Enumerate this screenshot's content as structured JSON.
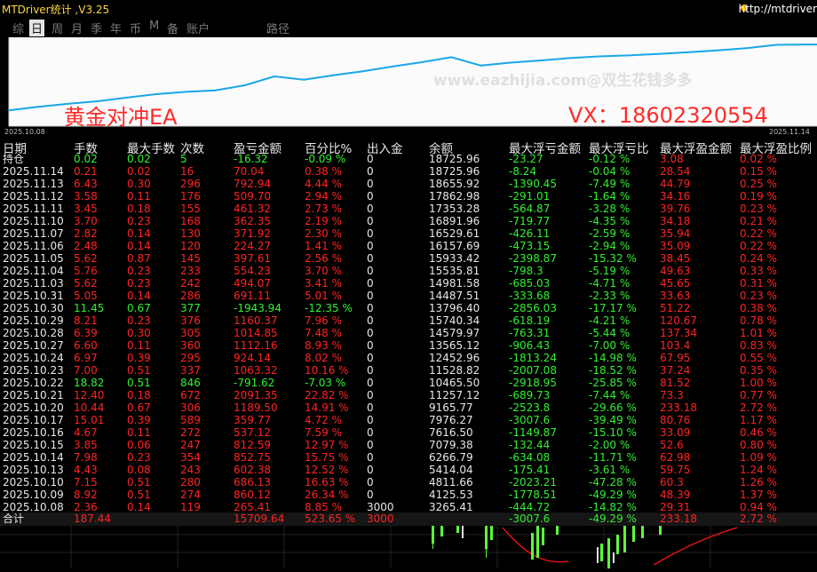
{
  "app": {
    "title": "MTDriver统计 ,V3.25",
    "url": "http://mtdriver"
  },
  "tabs": [
    "综",
    "日",
    "周",
    "月",
    "季",
    "年",
    "币",
    "M",
    "备",
    "账户",
    "路径"
  ],
  "active_tab": "日",
  "chart": {
    "watermark": "www.eazhijia.com@双生花钱多多",
    "label": "黄金对冲EA",
    "contact": "VX：18602320554",
    "start_date": "2025.10.08",
    "end_date": "2025.11.14",
    "line_color": "#1aa7e6",
    "chart_data": {
      "type": "line",
      "title": "",
      "xlabel": "",
      "ylabel": "",
      "x": [
        "2025.10.08",
        "2025.10.09",
        "2025.10.10",
        "2025.10.13",
        "2025.10.14",
        "2025.10.15",
        "2025.10.16",
        "2025.10.17",
        "2025.10.20",
        "2025.10.21",
        "2025.10.22",
        "2025.10.23",
        "2025.10.24",
        "2025.10.27",
        "2025.10.28",
        "2025.10.29",
        "2025.10.30",
        "2025.10.31",
        "2025.11.03",
        "2025.11.04",
        "2025.11.05",
        "2025.11.06",
        "2025.11.07",
        "2025.11.10",
        "2025.11.11",
        "2025.11.12",
        "2025.11.13",
        "2025.11.14"
      ],
      "values": [
        3265.41,
        4125.53,
        4811.66,
        5414.04,
        6266.79,
        7079.38,
        7616.5,
        7976.27,
        9165.77,
        11257.12,
        10465.5,
        11528.82,
        12452.96,
        13565.12,
        14579.97,
        15740.34,
        13796.4,
        14487.51,
        14981.58,
        15535.81,
        15933.42,
        16157.69,
        16529.61,
        16891.96,
        17353.28,
        17862.98,
        18655.92,
        18725.96
      ]
    }
  },
  "table": {
    "headers": [
      "日期",
      "手数",
      "最大手数",
      "次数",
      "盈亏金额",
      "百分比%",
      "出入金",
      "余额",
      "最大浮亏金额",
      "最大浮亏比",
      "最大浮盈金额",
      "最大浮盈比例"
    ],
    "rows": [
      {
        "date": "持仓",
        "lots": "0.02",
        "max_lots": "0.02",
        "count": "5",
        "pnl": "-16.32",
        "pct": "-0.09 %",
        "io": "0",
        "bal": "18725.96",
        "fl": "-23.27",
        "flp": "-0.12 %",
        "fp": "3.08",
        "fpp": "0.02 %",
        "color": "green"
      },
      {
        "date": "2025.11.14",
        "lots": "0.21",
        "max_lots": "0.02",
        "count": "16",
        "pnl": "70.04",
        "pct": "0.38 %",
        "io": "0",
        "bal": "18725.96",
        "fl": "-8.24",
        "flp": "-0.04 %",
        "fp": "28.54",
        "fpp": "0.15 %",
        "color": "red"
      },
      {
        "date": "2025.11.13",
        "lots": "6.43",
        "max_lots": "0.30",
        "count": "296",
        "pnl": "792.94",
        "pct": "4.44 %",
        "io": "0",
        "bal": "18655.92",
        "fl": "-1390.45",
        "flp": "-7.49 %",
        "fp": "44.79",
        "fpp": "0.25 %",
        "color": "red"
      },
      {
        "date": "2025.11.12",
        "lots": "3.58",
        "max_lots": "0.11",
        "count": "176",
        "pnl": "509.70",
        "pct": "2.94 %",
        "io": "0",
        "bal": "17862.98",
        "fl": "-291.01",
        "flp": "-1.64 %",
        "fp": "34.16",
        "fpp": "0.19 %",
        "color": "red"
      },
      {
        "date": "2025.11.11",
        "lots": "3.45",
        "max_lots": "0.18",
        "count": "155",
        "pnl": "461.32",
        "pct": "2.73 %",
        "io": "0",
        "bal": "17353.28",
        "fl": "-564.87",
        "flp": "-3.28 %",
        "fp": "39.76",
        "fpp": "0.23 %",
        "color": "red"
      },
      {
        "date": "2025.11.10",
        "lots": "3.70",
        "max_lots": "0.23",
        "count": "168",
        "pnl": "362.35",
        "pct": "2.19 %",
        "io": "0",
        "bal": "16891.96",
        "fl": "-719.77",
        "flp": "-4.35 %",
        "fp": "34.18",
        "fpp": "0.21 %",
        "color": "red"
      },
      {
        "date": "2025.11.07",
        "lots": "2.82",
        "max_lots": "0.14",
        "count": "130",
        "pnl": "371.92",
        "pct": "2.30 %",
        "io": "0",
        "bal": "16529.61",
        "fl": "-426.11",
        "flp": "-2.59 %",
        "fp": "35.94",
        "fpp": "0.22 %",
        "color": "red"
      },
      {
        "date": "2025.11.06",
        "lots": "2.48",
        "max_lots": "0.14",
        "count": "120",
        "pnl": "224.27",
        "pct": "1.41 %",
        "io": "0",
        "bal": "16157.69",
        "fl": "-473.15",
        "flp": "-2.94 %",
        "fp": "35.09",
        "fpp": "0.22 %",
        "color": "red"
      },
      {
        "date": "2025.11.05",
        "lots": "5.62",
        "max_lots": "0.87",
        "count": "145",
        "pnl": "397.61",
        "pct": "2.56 %",
        "io": "0",
        "bal": "15933.42",
        "fl": "-2398.87",
        "flp": "-15.32 %",
        "fp": "38.45",
        "fpp": "0.24 %",
        "color": "red"
      },
      {
        "date": "2025.11.04",
        "lots": "5.76",
        "max_lots": "0.23",
        "count": "233",
        "pnl": "554.23",
        "pct": "3.70 %",
        "io": "0",
        "bal": "15535.81",
        "fl": "-798.3",
        "flp": "-5.19 %",
        "fp": "49.63",
        "fpp": "0.33 %",
        "color": "red"
      },
      {
        "date": "2025.11.03",
        "lots": "5.62",
        "max_lots": "0.23",
        "count": "242",
        "pnl": "494.07",
        "pct": "3.41 %",
        "io": "0",
        "bal": "14981.58",
        "fl": "-685.03",
        "flp": "-4.71 %",
        "fp": "45.65",
        "fpp": "0.31 %",
        "color": "red"
      },
      {
        "date": "2025.10.31",
        "lots": "5.05",
        "max_lots": "0.14",
        "count": "286",
        "pnl": "691.11",
        "pct": "5.01 %",
        "io": "0",
        "bal": "14487.51",
        "fl": "-333.68",
        "flp": "-2.33 %",
        "fp": "33.63",
        "fpp": "0.23 %",
        "color": "red"
      },
      {
        "date": "2025.10.30",
        "lots": "11.45",
        "max_lots": "0.67",
        "count": "377",
        "pnl": "-1943.94",
        "pct": "-12.35 %",
        "io": "0",
        "bal": "13796.40",
        "fl": "-2856.03",
        "flp": "-17.17 %",
        "fp": "51.22",
        "fpp": "0.38 %",
        "color": "green"
      },
      {
        "date": "2025.10.29",
        "lots": "8.21",
        "max_lots": "0.23",
        "count": "376",
        "pnl": "1160.37",
        "pct": "7.96 %",
        "io": "0",
        "bal": "15740.34",
        "fl": "-618.19",
        "flp": "-4.21 %",
        "fp": "120.67",
        "fpp": "0.78 %",
        "color": "red"
      },
      {
        "date": "2025.10.28",
        "lots": "6.39",
        "max_lots": "0.30",
        "count": "305",
        "pnl": "1014.85",
        "pct": "7.48 %",
        "io": "0",
        "bal": "14579.97",
        "fl": "-763.31",
        "flp": "-5.44 %",
        "fp": "137.34",
        "fpp": "1.01 %",
        "color": "red"
      },
      {
        "date": "2025.10.27",
        "lots": "6.60",
        "max_lots": "0.11",
        "count": "360",
        "pnl": "1112.16",
        "pct": "8.93 %",
        "io": "0",
        "bal": "13565.12",
        "fl": "-906.43",
        "flp": "-7.00 %",
        "fp": "103.4",
        "fpp": "0.83 %",
        "color": "red"
      },
      {
        "date": "2025.10.24",
        "lots": "6.97",
        "max_lots": "0.39",
        "count": "295",
        "pnl": "924.14",
        "pct": "8.02 %",
        "io": "0",
        "bal": "12452.96",
        "fl": "-1813.24",
        "flp": "-14.98 %",
        "fp": "67.95",
        "fpp": "0.55 %",
        "color": "red"
      },
      {
        "date": "2025.10.23",
        "lots": "7.00",
        "max_lots": "0.51",
        "count": "337",
        "pnl": "1063.32",
        "pct": "10.16 %",
        "io": "0",
        "bal": "11528.82",
        "fl": "-2007.08",
        "flp": "-18.52 %",
        "fp": "37.24",
        "fpp": "0.35 %",
        "color": "red"
      },
      {
        "date": "2025.10.22",
        "lots": "18.82",
        "max_lots": "0.51",
        "count": "846",
        "pnl": "-791.62",
        "pct": "-7.03 %",
        "io": "0",
        "bal": "10465.50",
        "fl": "-2918.95",
        "flp": "-25.85 %",
        "fp": "81.52",
        "fpp": "1.00 %",
        "color": "green"
      },
      {
        "date": "2025.10.21",
        "lots": "12.40",
        "max_lots": "0.18",
        "count": "672",
        "pnl": "2091.35",
        "pct": "22.82 %",
        "io": "0",
        "bal": "11257.12",
        "fl": "-689.73",
        "flp": "-7.44 %",
        "fp": "73.3",
        "fpp": "0.77 %",
        "color": "red"
      },
      {
        "date": "2025.10.20",
        "lots": "10.44",
        "max_lots": "0.67",
        "count": "306",
        "pnl": "1189.50",
        "pct": "14.91 %",
        "io": "0",
        "bal": "9165.77",
        "fl": "-2523.8",
        "flp": "-29.66 %",
        "fp": "233.18",
        "fpp": "2.72 %",
        "color": "red"
      },
      {
        "date": "2025.10.17",
        "lots": "15.01",
        "max_lots": "0.39",
        "count": "589",
        "pnl": "359.77",
        "pct": "4.72 %",
        "io": "0",
        "bal": "7976.27",
        "fl": "-3007.6",
        "flp": "-39.49 %",
        "fp": "80.76",
        "fpp": "1.17 %",
        "color": "red"
      },
      {
        "date": "2025.10.16",
        "lots": "4.67",
        "max_lots": "0.11",
        "count": "272",
        "pnl": "537.12",
        "pct": "7.59 %",
        "io": "0",
        "bal": "7616.50",
        "fl": "-1149.87",
        "flp": "-15.10 %",
        "fp": "33.09",
        "fpp": "0.46 %",
        "color": "red"
      },
      {
        "date": "2025.10.15",
        "lots": "3.85",
        "max_lots": "0.06",
        "count": "247",
        "pnl": "812.59",
        "pct": "12.97 %",
        "io": "0",
        "bal": "7079.38",
        "fl": "-132.44",
        "flp": "-2.00 %",
        "fp": "52.6",
        "fpp": "0.80 %",
        "color": "red"
      },
      {
        "date": "2025.10.14",
        "lots": "7.98",
        "max_lots": "0.23",
        "count": "354",
        "pnl": "852.75",
        "pct": "15.75 %",
        "io": "0",
        "bal": "6266.79",
        "fl": "-634.08",
        "flp": "-11.71 %",
        "fp": "62.98",
        "fpp": "1.09 %",
        "color": "red"
      },
      {
        "date": "2025.10.13",
        "lots": "4.43",
        "max_lots": "0.08",
        "count": "243",
        "pnl": "602.38",
        "pct": "12.52 %",
        "io": "0",
        "bal": "5414.04",
        "fl": "-175.41",
        "flp": "-3.61 %",
        "fp": "59.75",
        "fpp": "1.24 %",
        "color": "red"
      },
      {
        "date": "2025.10.10",
        "lots": "7.15",
        "max_lots": "0.51",
        "count": "280",
        "pnl": "686.13",
        "pct": "16.63 %",
        "io": "0",
        "bal": "4811.66",
        "fl": "-2023.21",
        "flp": "-47.28 %",
        "fp": "60.3",
        "fpp": "1.26 %",
        "color": "red"
      },
      {
        "date": "2025.10.09",
        "lots": "8.92",
        "max_lots": "0.51",
        "count": "274",
        "pnl": "860.12",
        "pct": "26.34 %",
        "io": "0",
        "bal": "4125.53",
        "fl": "-1778.51",
        "flp": "-49.29 %",
        "fp": "48.39",
        "fpp": "1.37 %",
        "color": "red"
      },
      {
        "date": "2025.10.08",
        "lots": "2.36",
        "max_lots": "0.14",
        "count": "119",
        "pnl": "265.41",
        "pct": "8.85 %",
        "io": "3000",
        "bal": "3265.41",
        "fl": "-444.72",
        "flp": "-14.82 %",
        "fp": "29.31",
        "fpp": "0.94 %",
        "color": "red"
      }
    ],
    "total": {
      "label": "合计",
      "lots": "187.44",
      "pnl": "15709.64",
      "pct": "523.65 %",
      "io": "3000",
      "fl": "-3007.6",
      "flp": "-49.29 %",
      "fp": "233.18",
      "fpp": "2.72 %"
    }
  },
  "colors": {
    "positive": "#ff2323",
    "negative": "#31f031",
    "header_text": "#e8e8e8",
    "accent_title": "#ffd83a"
  }
}
